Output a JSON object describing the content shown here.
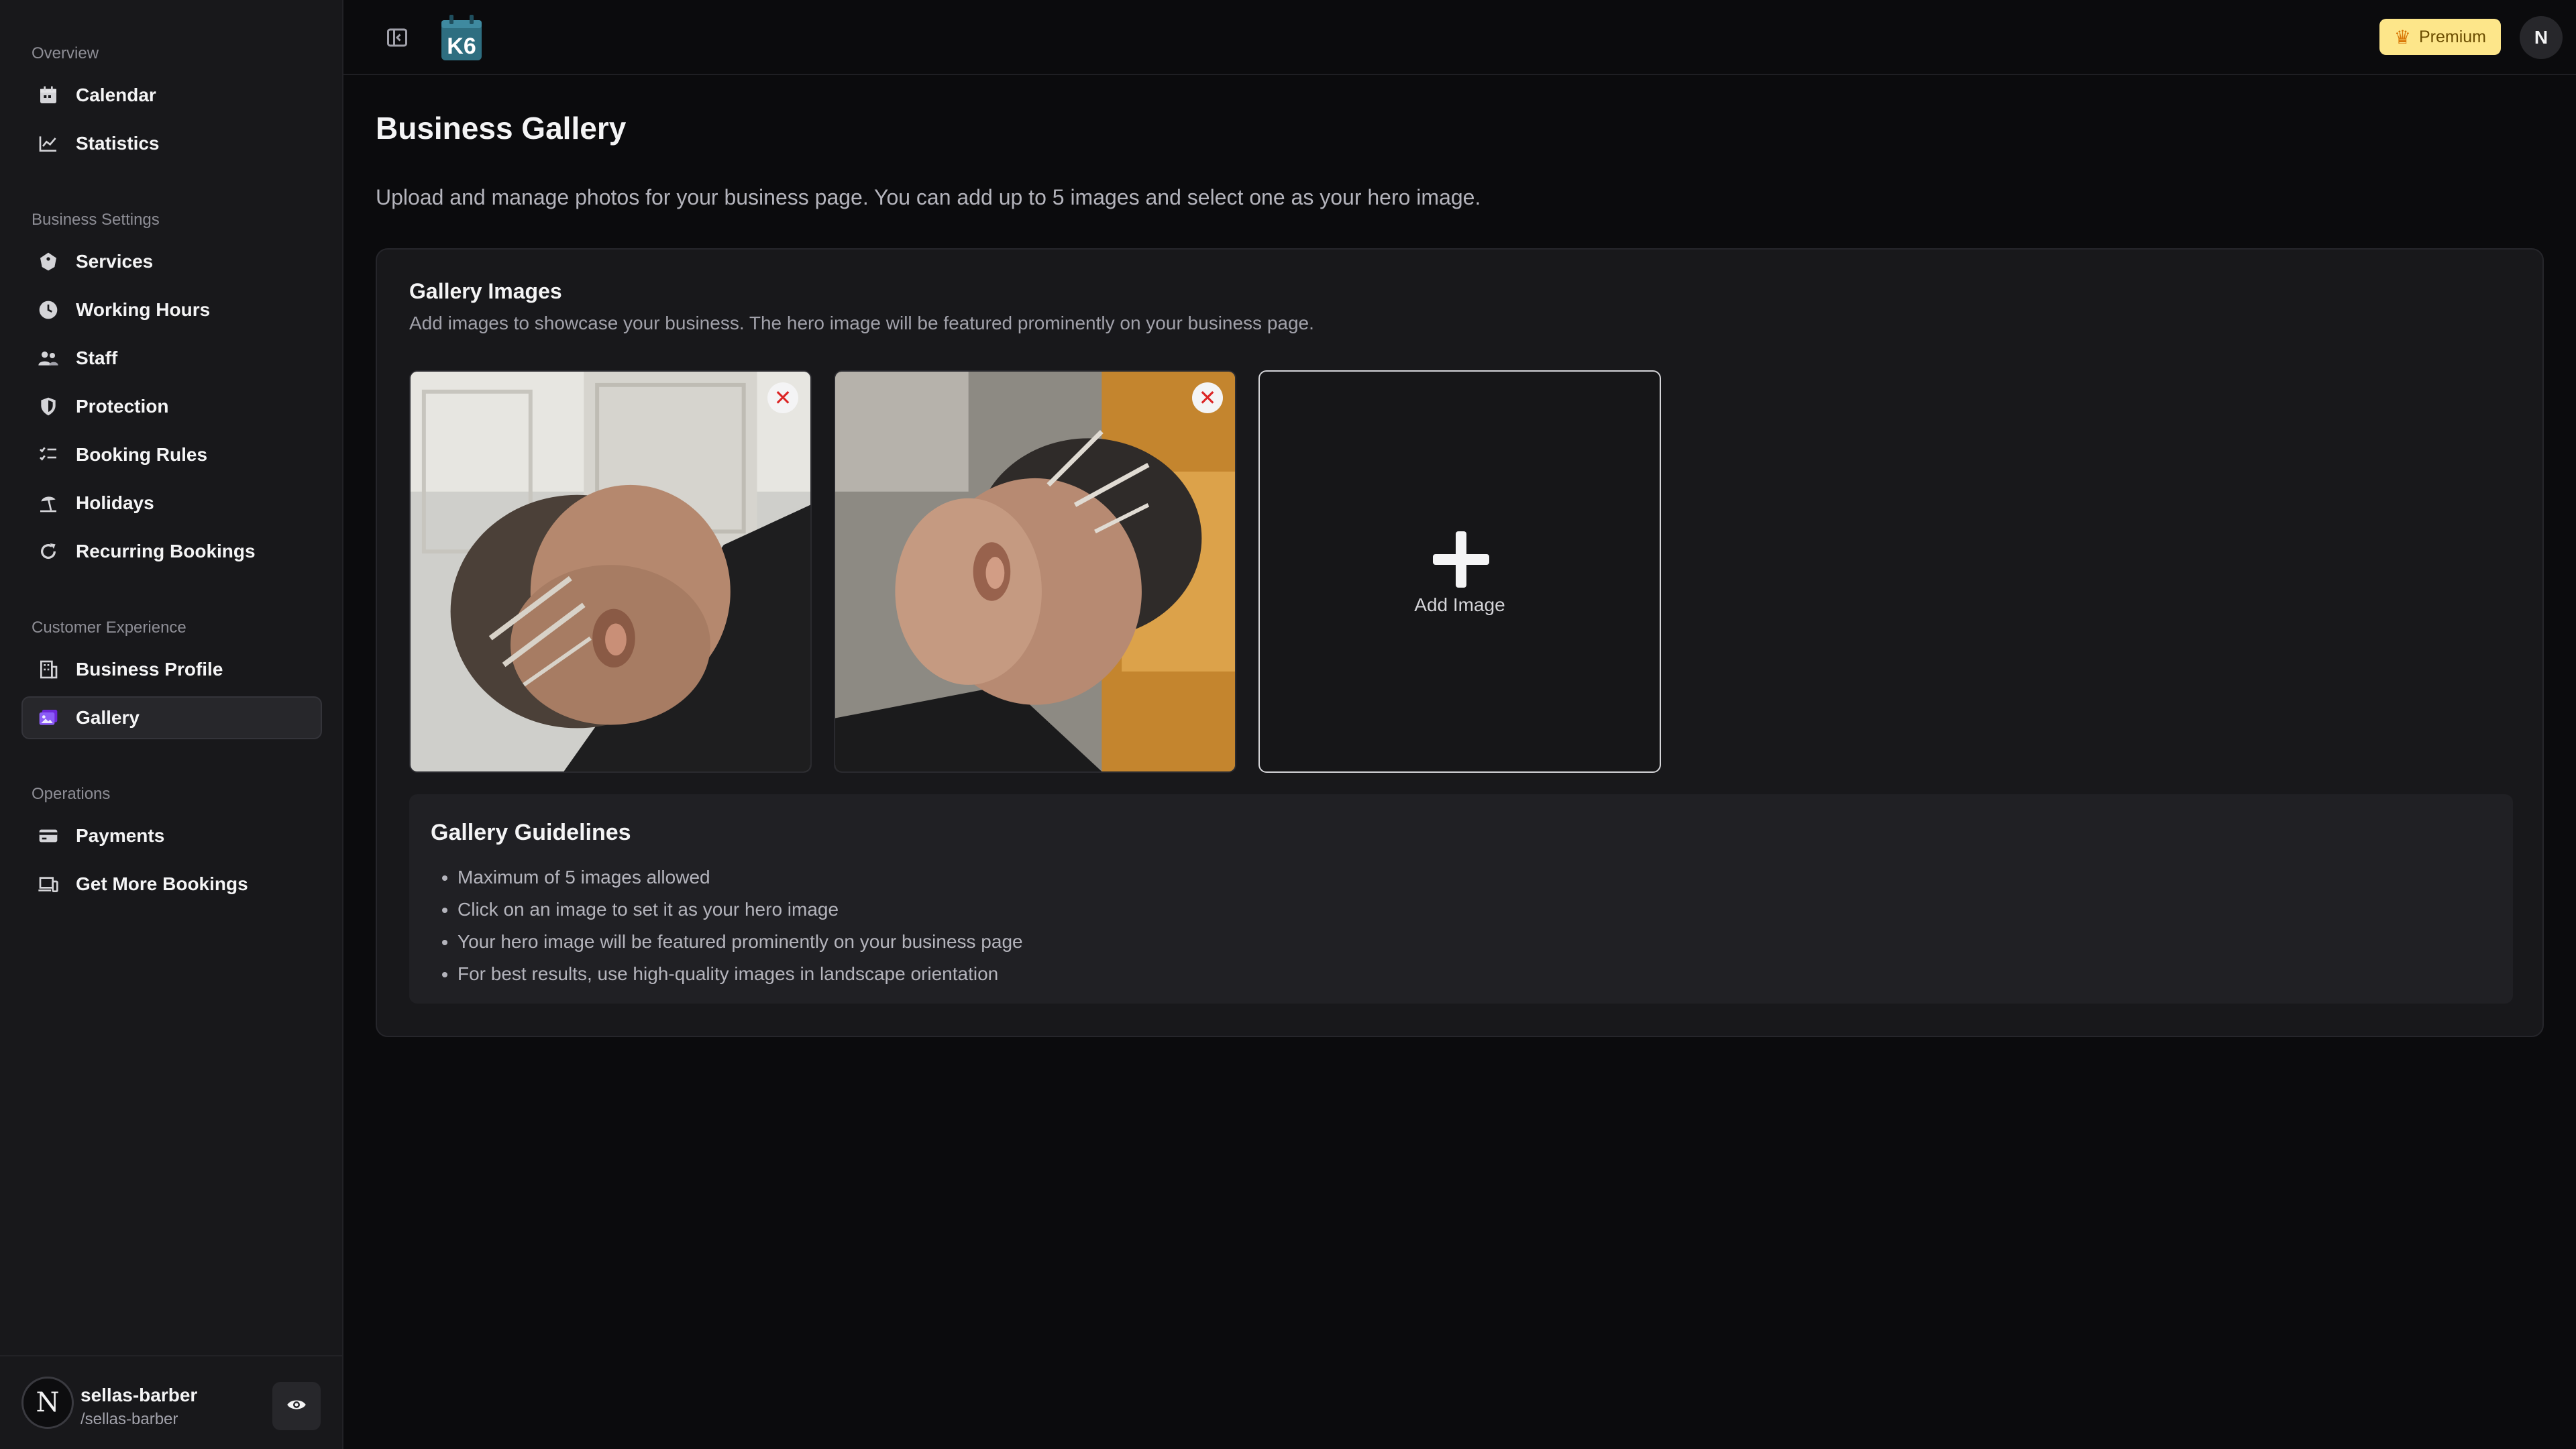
{
  "sidebar": {
    "sections": [
      {
        "title": "Overview",
        "items": [
          {
            "label": "Calendar",
            "icon": "calendar-icon"
          },
          {
            "label": "Statistics",
            "icon": "chart-line-icon"
          }
        ]
      },
      {
        "title": "Business Settings",
        "items": [
          {
            "label": "Services",
            "icon": "tag-icon"
          },
          {
            "label": "Working Hours",
            "icon": "clock-icon"
          },
          {
            "label": "Staff",
            "icon": "users-icon"
          },
          {
            "label": "Protection",
            "icon": "shield-icon"
          },
          {
            "label": "Booking Rules",
            "icon": "list-check-icon"
          },
          {
            "label": "Holidays",
            "icon": "beach-icon"
          },
          {
            "label": "Recurring Bookings",
            "icon": "refresh-icon"
          }
        ]
      },
      {
        "title": "Customer Experience",
        "items": [
          {
            "label": "Business Profile",
            "icon": "building-icon"
          },
          {
            "label": "Gallery",
            "icon": "image-icon",
            "active": true
          }
        ]
      },
      {
        "title": "Operations",
        "items": [
          {
            "label": "Payments",
            "icon": "credit-card-icon"
          },
          {
            "label": "Get More Bookings",
            "icon": "devices-icon"
          }
        ]
      }
    ],
    "footer": {
      "avatar_letter": "N",
      "name": "sellas-barber",
      "slug": "/sellas-barber"
    }
  },
  "topbar": {
    "logo_text": "K6",
    "premium_label": "Premium",
    "avatar_letter": "N"
  },
  "page": {
    "title": "Business Gallery",
    "description": "Upload and manage photos for your business page. You can add up to 5 images and select one as your hero image."
  },
  "gallery": {
    "title": "Gallery Images",
    "description": "Add images to showcase your business. The hero image will be featured prominently on your business page.",
    "remove_symbol": "✕",
    "add_label": "Add Image"
  },
  "guidelines": {
    "title": "Gallery Guidelines",
    "items": [
      "Maximum of 5 images allowed",
      "Click on an image to set it as your hero image",
      "Your hero image will be featured prominently on your business page",
      "For best results, use high-quality images in landscape orientation"
    ]
  },
  "colors": {
    "accent": "#8b5cf6",
    "premium_bg": "#fde68a",
    "danger": "#dc2626"
  }
}
